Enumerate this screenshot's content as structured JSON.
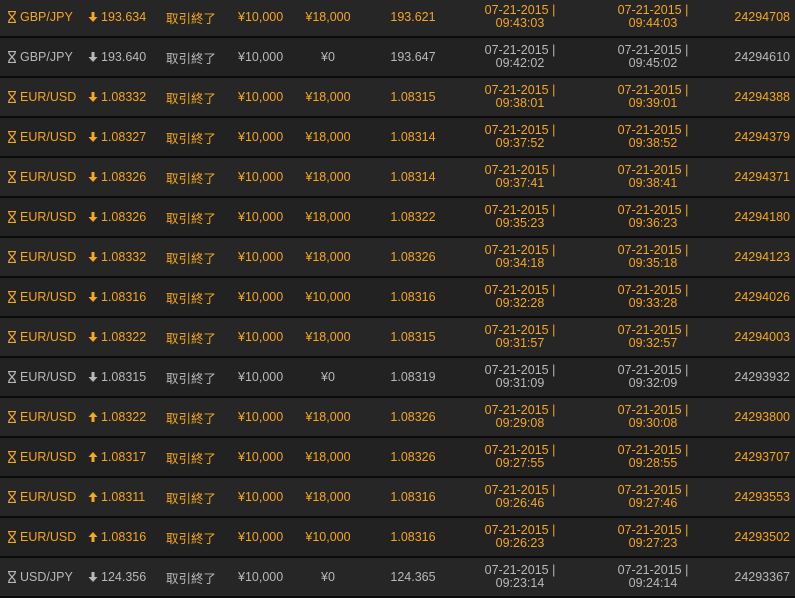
{
  "colors": {
    "highlight": "#f5a623",
    "muted": "#b8b8b8",
    "row_bg": "#262626",
    "separator": "#0b0b0b"
  },
  "icons": {
    "status": "hourglass-icon",
    "down": "arrow-down-icon",
    "up": "arrow-up-icon"
  },
  "trades": [
    {
      "pair": "GBP/JPY",
      "direction": "down",
      "rate": "193.634",
      "status": "取引終了",
      "investment": "¥10,000",
      "payout": "¥18,000",
      "closing_rate": "193.621",
      "open_date": "07-21-2015 |",
      "open_time": "09:43:03",
      "close_date": "07-21-2015 |",
      "close_time": "09:44:03",
      "id": "24294708",
      "tone": "hi"
    },
    {
      "pair": "GBP/JPY",
      "direction": "down",
      "rate": "193.640",
      "status": "取引終了",
      "investment": "¥10,000",
      "payout": "¥0",
      "closing_rate": "193.647",
      "open_date": "07-21-2015 |",
      "open_time": "09:42:02",
      "close_date": "07-21-2015 |",
      "close_time": "09:45:02",
      "id": "24294610",
      "tone": "mu"
    },
    {
      "pair": "EUR/USD",
      "direction": "down",
      "rate": "1.08332",
      "status": "取引終了",
      "investment": "¥10,000",
      "payout": "¥18,000",
      "closing_rate": "1.08315",
      "open_date": "07-21-2015 |",
      "open_time": "09:38:01",
      "close_date": "07-21-2015 |",
      "close_time": "09:39:01",
      "id": "24294388",
      "tone": "hi"
    },
    {
      "pair": "EUR/USD",
      "direction": "down",
      "rate": "1.08327",
      "status": "取引終了",
      "investment": "¥10,000",
      "payout": "¥18,000",
      "closing_rate": "1.08314",
      "open_date": "07-21-2015 |",
      "open_time": "09:37:52",
      "close_date": "07-21-2015 |",
      "close_time": "09:38:52",
      "id": "24294379",
      "tone": "hi"
    },
    {
      "pair": "EUR/USD",
      "direction": "down",
      "rate": "1.08326",
      "status": "取引終了",
      "investment": "¥10,000",
      "payout": "¥18,000",
      "closing_rate": "1.08314",
      "open_date": "07-21-2015 |",
      "open_time": "09:37:41",
      "close_date": "07-21-2015 |",
      "close_time": "09:38:41",
      "id": "24294371",
      "tone": "hi"
    },
    {
      "pair": "EUR/USD",
      "direction": "down",
      "rate": "1.08326",
      "status": "取引終了",
      "investment": "¥10,000",
      "payout": "¥18,000",
      "closing_rate": "1.08322",
      "open_date": "07-21-2015 |",
      "open_time": "09:35:23",
      "close_date": "07-21-2015 |",
      "close_time": "09:36:23",
      "id": "24294180",
      "tone": "hi"
    },
    {
      "pair": "EUR/USD",
      "direction": "down",
      "rate": "1.08332",
      "status": "取引終了",
      "investment": "¥10,000",
      "payout": "¥18,000",
      "closing_rate": "1.08326",
      "open_date": "07-21-2015 |",
      "open_time": "09:34:18",
      "close_date": "07-21-2015 |",
      "close_time": "09:35:18",
      "id": "24294123",
      "tone": "hi"
    },
    {
      "pair": "EUR/USD",
      "direction": "down",
      "rate": "1.08316",
      "status": "取引終了",
      "investment": "¥10,000",
      "payout": "¥10,000",
      "closing_rate": "1.08316",
      "open_date": "07-21-2015 |",
      "open_time": "09:32:28",
      "close_date": "07-21-2015 |",
      "close_time": "09:33:28",
      "id": "24294026",
      "tone": "hi"
    },
    {
      "pair": "EUR/USD",
      "direction": "down",
      "rate": "1.08322",
      "status": "取引終了",
      "investment": "¥10,000",
      "payout": "¥18,000",
      "closing_rate": "1.08315",
      "open_date": "07-21-2015 |",
      "open_time": "09:31:57",
      "close_date": "07-21-2015 |",
      "close_time": "09:32:57",
      "id": "24294003",
      "tone": "hi"
    },
    {
      "pair": "EUR/USD",
      "direction": "down",
      "rate": "1.08315",
      "status": "取引終了",
      "investment": "¥10,000",
      "payout": "¥0",
      "closing_rate": "1.08319",
      "open_date": "07-21-2015 |",
      "open_time": "09:31:09",
      "close_date": "07-21-2015 |",
      "close_time": "09:32:09",
      "id": "24293932",
      "tone": "mu"
    },
    {
      "pair": "EUR/USD",
      "direction": "up",
      "rate": "1.08322",
      "status": "取引終了",
      "investment": "¥10,000",
      "payout": "¥18,000",
      "closing_rate": "1.08326",
      "open_date": "07-21-2015 |",
      "open_time": "09:29:08",
      "close_date": "07-21-2015 |",
      "close_time": "09:30:08",
      "id": "24293800",
      "tone": "hi"
    },
    {
      "pair": "EUR/USD",
      "direction": "up",
      "rate": "1.08317",
      "status": "取引終了",
      "investment": "¥10,000",
      "payout": "¥18,000",
      "closing_rate": "1.08326",
      "open_date": "07-21-2015 |",
      "open_time": "09:27:55",
      "close_date": "07-21-2015 |",
      "close_time": "09:28:55",
      "id": "24293707",
      "tone": "hi"
    },
    {
      "pair": "EUR/USD",
      "direction": "up",
      "rate": "1.08311",
      "status": "取引終了",
      "investment": "¥10,000",
      "payout": "¥18,000",
      "closing_rate": "1.08316",
      "open_date": "07-21-2015 |",
      "open_time": "09:26:46",
      "close_date": "07-21-2015 |",
      "close_time": "09:27:46",
      "id": "24293553",
      "tone": "hi"
    },
    {
      "pair": "EUR/USD",
      "direction": "up",
      "rate": "1.08316",
      "status": "取引終了",
      "investment": "¥10,000",
      "payout": "¥10,000",
      "closing_rate": "1.08316",
      "open_date": "07-21-2015 |",
      "open_time": "09:26:23",
      "close_date": "07-21-2015 |",
      "close_time": "09:27:23",
      "id": "24293502",
      "tone": "hi"
    },
    {
      "pair": "USD/JPY",
      "direction": "down",
      "rate": "124.356",
      "status": "取引終了",
      "investment": "¥10,000",
      "payout": "¥0",
      "closing_rate": "124.365",
      "open_date": "07-21-2015 |",
      "open_time": "09:23:14",
      "close_date": "07-21-2015 |",
      "close_time": "09:24:14",
      "id": "24293367",
      "tone": "mu"
    }
  ]
}
